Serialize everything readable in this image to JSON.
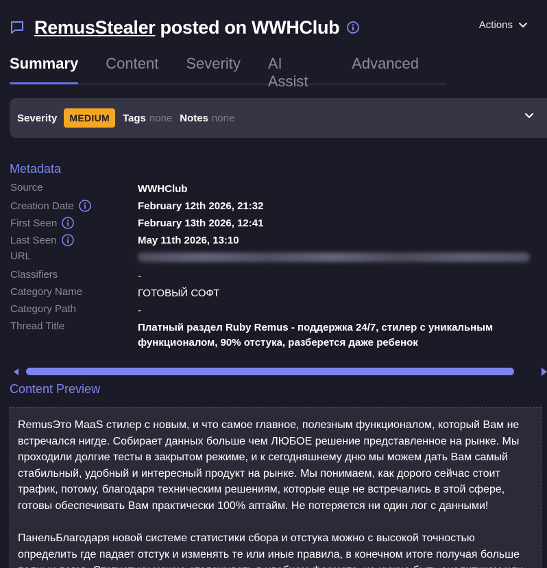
{
  "header": {
    "user": "RemusStealer",
    "title_rest": "posted on WWHClub",
    "actions_label": "Actions"
  },
  "tabs": [
    {
      "label": "Summary",
      "active": true
    },
    {
      "label": "Content",
      "active": false
    },
    {
      "label": "Severity",
      "active": false
    },
    {
      "label": "AI Assist",
      "active": false
    },
    {
      "label": "Advanced",
      "active": false
    }
  ],
  "severity_bar": {
    "severity_label": "Severity",
    "severity_value": "MEDIUM",
    "tags_label": "Tags",
    "tags_value": "none",
    "notes_label": "Notes",
    "notes_value": "none"
  },
  "metadata": {
    "title": "Metadata",
    "source_label": "Source",
    "source_value": "WWHClub",
    "creation_label": "Creation Date",
    "creation_value": "February 12th 2026, 21:32",
    "first_seen_label": "First Seen",
    "first_seen_value": "February 13th 2026, 12:41",
    "last_seen_label": "Last Seen",
    "last_seen_value": "May 11th 2026, 13:10",
    "url_label": "URL",
    "classifiers_label": "Classifiers",
    "classifiers_value": "-",
    "category_name_label": "Category Name",
    "category_name_value": "ГОТОВЫЙ СОФТ",
    "category_path_label": "Category Path",
    "category_path_value": "-",
    "thread_title_label": "Thread Title",
    "thread_title_value": "Платный раздел Ruby Remus - поддержка 24/7, стилер с уникальным функционалом, 90% отстука, разберется даже ребенок"
  },
  "content_preview": {
    "title": "Content Preview",
    "paragraphs": [
      "RemusЭто MaaS стилер с новым, и что самое главное, полезным функционалом, который Вам не встречался нигде. Собирает данных больше чем ЛЮБОЕ решение представленное на рынке. Мы проходили долгие тесты в закрытом режиме, и к сегодняшнему дню мы можем дать Вам самый стабильный, удобный и интересный продукт на рынке. Мы понимаем, как дорого сейчас стоит трафик, потому, благодаря техническим решениям, которые еще не встречались в этой сфере, готовы обеспечивать Вам практически 100% аптайм. Не потеряется ни один лог с данными!",
      "ПанельБлагодаря новой системе статистики сбора и отстука можно с высокой точностью определить где падает отстук и изменять те или иные правила, в конечном итоге получая больше полных логов. Статистику можно отслеживать в удобном формате, не нужно быть аналитиком или"
    ]
  },
  "colors": {
    "background": "#1b1b27",
    "accent": "#7d86f0",
    "severity_medium": "#f5a623",
    "panel": "#353545"
  },
  "icons": {
    "header": "chat-bubble-icon",
    "title_info": "info-icon",
    "actions": "chevron-down-icon",
    "expand": "chevron-down-icon"
  }
}
